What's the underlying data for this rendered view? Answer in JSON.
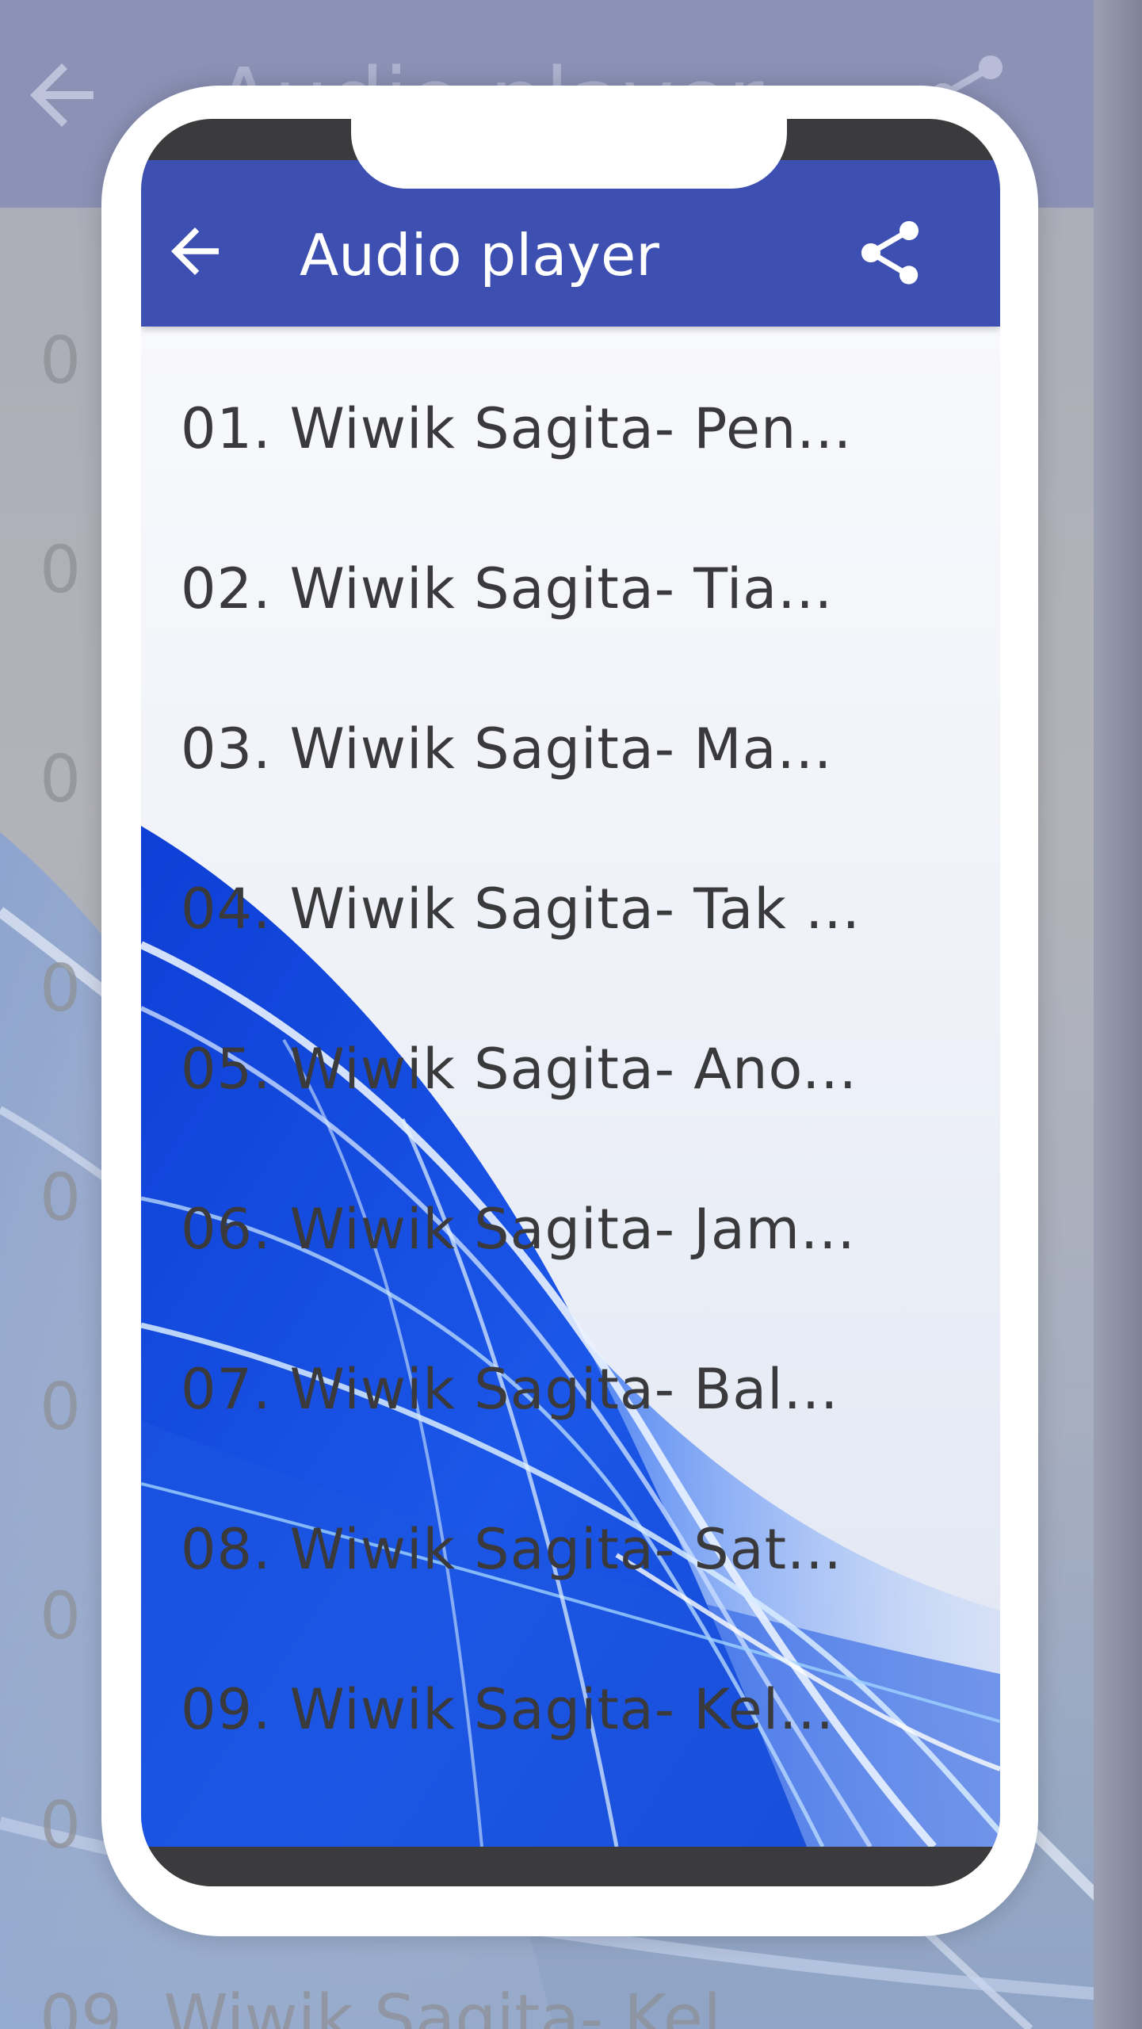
{
  "app": {
    "title": "Audio player",
    "back_icon": "arrow-left-icon",
    "share_icon": "share-icon",
    "accent_color": "#3e4fb2"
  },
  "tracks": [
    {
      "label": "01. Wiwik Sagita- Pen..."
    },
    {
      "label": "02. Wiwik Sagita- Tia..."
    },
    {
      "label": "03. Wiwik Sagita- Ma..."
    },
    {
      "label": "04. Wiwik Sagita- Tak ..."
    },
    {
      "label": "05. Wiwik Sagita- Ano..."
    },
    {
      "label": "06. Wiwik Sagita- Jam..."
    },
    {
      "label": "07. Wiwik Sagita- Bal..."
    },
    {
      "label": "08. Wiwik Sagita- Sat..."
    },
    {
      "label": "09. Wiwik Sagita- Kel..."
    }
  ],
  "background": {
    "items": [
      "0",
      "0",
      "0",
      "0",
      "0",
      "0",
      "0",
      "0",
      "0",
      "09. Wiwik Sagita- Kel"
    ]
  }
}
